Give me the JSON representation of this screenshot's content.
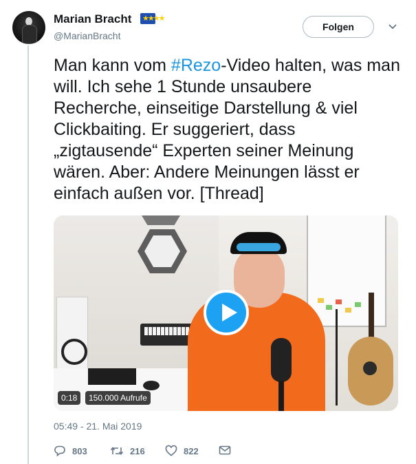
{
  "author": {
    "name": "Marian Bracht",
    "handle": "@MarianBracht",
    "badge_icon": "eu-flag-icon"
  },
  "follow_button": {
    "label": "Folgen"
  },
  "more_menu_icon": "chevron-down-icon",
  "tweet": {
    "text_before_hashtag": "Man kann vom ",
    "hashtag": "#Rezo",
    "text_after_hashtag": "-Video halten, was man will. Ich sehe 1 Stunde unsaubere Recherche, einseitige Darstellung & viel Clickbaiting. Er suggeriert, dass „zigtausende“ Experten seiner Meinung wären. Aber: Andere Meinungen lässt er einfach außen vor. [Thread]"
  },
  "media": {
    "duration": "0:18",
    "views": "150.000 Aufrufe",
    "play_icon": "play-icon"
  },
  "timestamp": "05:49 - 21. Mai 2019",
  "actions": {
    "reply_count": "803",
    "retweet_count": "216",
    "like_count": "822"
  },
  "colors": {
    "link": "#1b95e0",
    "play_button": "#1da1f2",
    "secondary_text": "#657786"
  }
}
